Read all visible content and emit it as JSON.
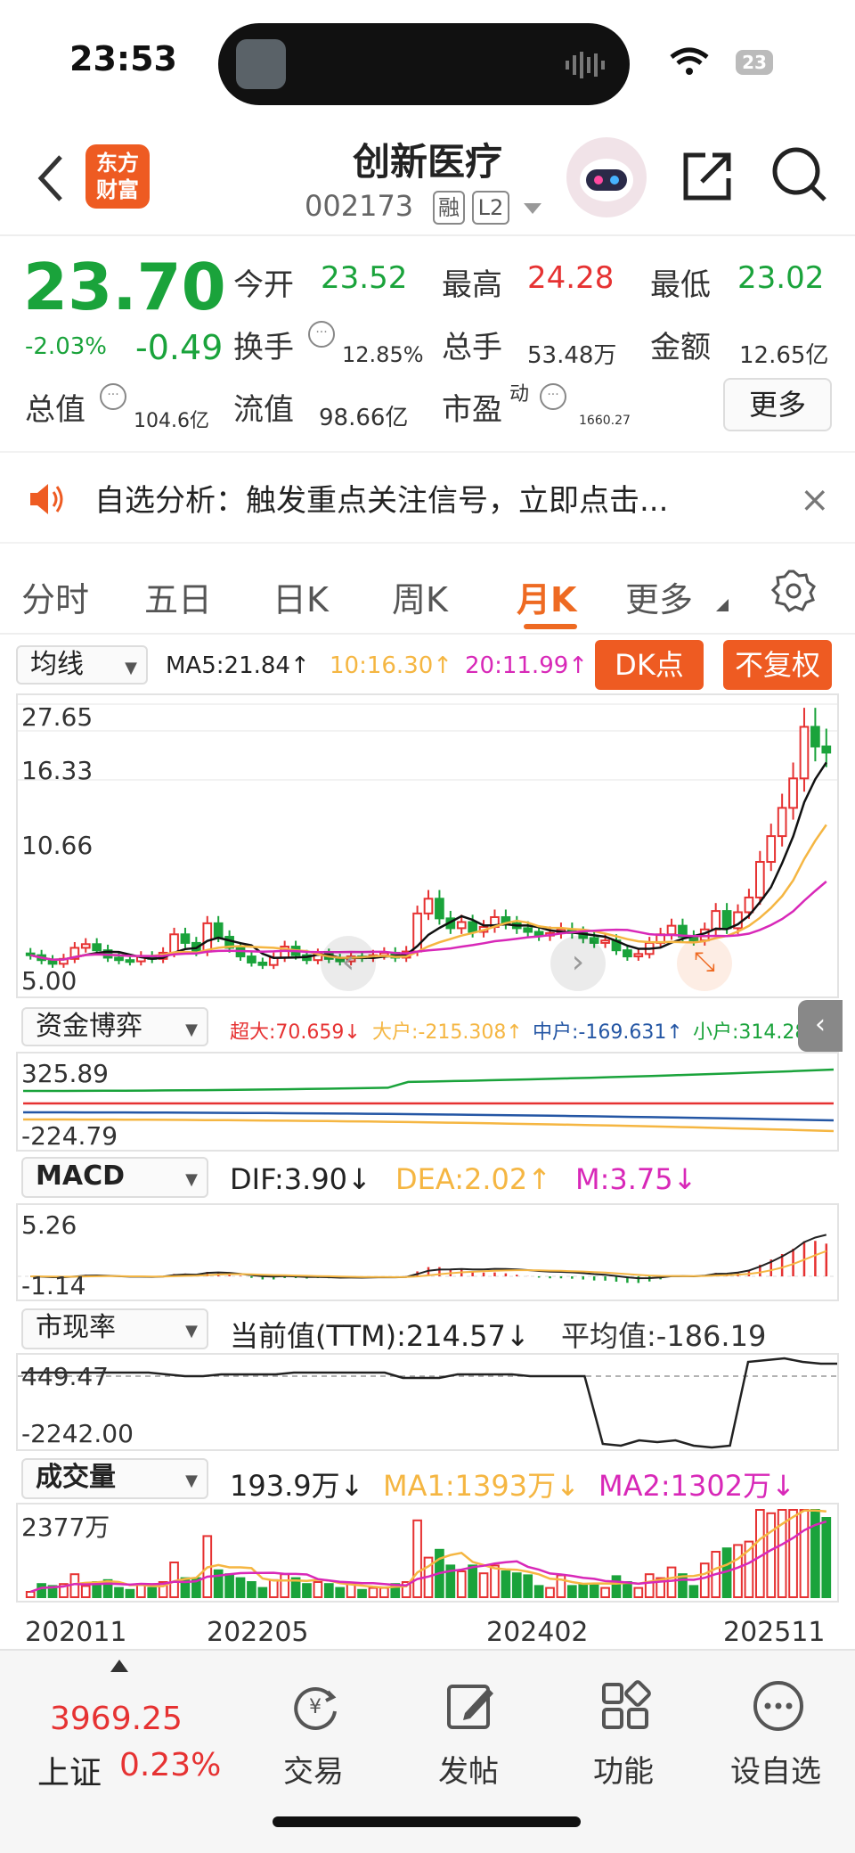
{
  "status": {
    "time": "23:53",
    "battery": "23"
  },
  "header": {
    "name": "创新医疗",
    "code": "002173",
    "tag1": "融",
    "tag2": "L2",
    "logo_line1": "东方",
    "logo_line2": "财富"
  },
  "quote": {
    "price": "23.70",
    "change_pct": "-2.03%",
    "change": "-0.49",
    "open_label": "今开",
    "open": "23.52",
    "high_label": "最高",
    "high": "24.28",
    "low_label": "最低",
    "low": "23.02",
    "turnover_label": "换手",
    "turnover": "12.85%",
    "volume_label": "总手",
    "volume": "53.48万",
    "amount_label": "金额",
    "amount": "12.65亿",
    "mcap_label": "总值",
    "mcap": "104.6亿",
    "float_label": "流值",
    "float": "98.66亿",
    "pe_label": "市盈",
    "pe_sup": "动",
    "pe": "1660.27",
    "more_label": "更多"
  },
  "notice": {
    "text": "自选分析：触发重点关注信号，立即点击...",
    "close": "×"
  },
  "tabs": [
    "分时",
    "五日",
    "日K",
    "周K",
    "月K",
    "更多"
  ],
  "kline": {
    "selector": "均线",
    "ma5": "MA5:21.84↑",
    "ma10": "10:16.30↑",
    "ma20": "20:11.99↑",
    "dk_button": "DK点",
    "fq_button": "不复权",
    "y_labels": [
      "27.65",
      "16.33",
      "10.66",
      "5.00"
    ],
    "colors": {
      "up": "#e63232",
      "down": "#1aa33b",
      "ma5": "#111111",
      "ma10": "#f5b642",
      "ma20": "#d828b8",
      "accent": "#ee6a22"
    }
  },
  "fund": {
    "selector": "资金博弈",
    "super": "超大:70.659↓",
    "big": "大户:-215.308↑",
    "mid": "中户:-169.631↑",
    "small": "小户:314.280",
    "y_labels": [
      "325.89",
      "-224.79"
    ]
  },
  "macd": {
    "selector": "MACD",
    "dif": "DIF:3.90↓",
    "dea": "DEA:2.02↑",
    "m": "M:3.75↓",
    "y_labels": [
      "5.26",
      "-1.14"
    ]
  },
  "pe_ratio": {
    "selector": "市现率",
    "current": "当前值(TTM):214.57↓",
    "average": "平均值:-186.19",
    "y_labels": [
      "449.47",
      "-2242.00"
    ]
  },
  "volume": {
    "selector": "成交量",
    "value": "193.9万↓",
    "ma1": "MA1:1393万↓",
    "ma2": "MA2:1302万↓",
    "y_label": "2377万"
  },
  "dates": [
    "202011",
    "202205",
    "202402",
    "202511"
  ],
  "bottom": {
    "index_value": "3969.25",
    "index_name": "上证",
    "index_pct": "0.23%",
    "nav": [
      "交易",
      "发帖",
      "功能",
      "设自选"
    ]
  },
  "chart_data": {
    "type": "candlestick",
    "title": "",
    "x_start": "202011",
    "x_end": "202511",
    "ylim": [
      5.0,
      27.65
    ],
    "ma_labels": [
      "MA5",
      "10",
      "20"
    ],
    "closes": [
      7.2,
      6.8,
      6.5,
      6.9,
      7.8,
      8.1,
      7.6,
      7.0,
      6.8,
      6.7,
      7.1,
      6.9,
      7.4,
      8.9,
      8.2,
      7.5,
      9.8,
      8.7,
      7.8,
      7.1,
      6.6,
      6.4,
      7.0,
      7.9,
      7.2,
      6.8,
      7.3,
      6.9,
      6.7,
      7.1,
      7.0,
      7.2,
      7.4,
      7.0,
      7.5,
      10.6,
      11.8,
      10.2,
      9.4,
      9.9,
      9.1,
      9.5,
      10.3,
      9.8,
      9.4,
      9.1,
      8.8,
      9.0,
      9.3,
      9.0,
      8.6,
      8.2,
      8.4,
      7.6,
      7.1,
      7.3,
      8.2,
      8.9,
      9.6,
      8.7,
      8.4,
      9.3,
      10.8,
      9.4,
      10.7,
      11.9,
      14.8,
      16.9,
      19.2,
      21.6,
      25.8,
      24.2,
      23.7
    ]
  }
}
